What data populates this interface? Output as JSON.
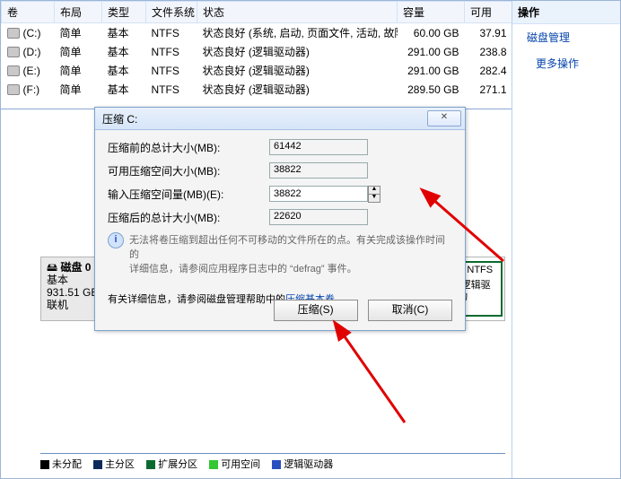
{
  "rightPane": {
    "header": "操作",
    "items": [
      "磁盘管理",
      "更多操作"
    ]
  },
  "table": {
    "headers": {
      "vol": "卷",
      "layout": "布局",
      "type": "类型",
      "fs": "文件系统",
      "status": "状态",
      "cap": "容量",
      "free": "可用"
    },
    "rows": [
      {
        "vol": "(C:)",
        "layout": "简单",
        "type": "基本",
        "fs": "NTFS",
        "status": "状态良好 (系统, 启动, 页面文件, 活动, 故障转储, 主分区)",
        "cap": "60.00 GB",
        "free": "37.91"
      },
      {
        "vol": "(D:)",
        "layout": "简单",
        "type": "基本",
        "fs": "NTFS",
        "status": "状态良好 (逻辑驱动器)",
        "cap": "291.00 GB",
        "free": "238.8"
      },
      {
        "vol": "(E:)",
        "layout": "简单",
        "type": "基本",
        "fs": "NTFS",
        "status": "状态良好 (逻辑驱动器)",
        "cap": "291.00 GB",
        "free": "282.4"
      },
      {
        "vol": "(F:)",
        "layout": "简单",
        "type": "基本",
        "fs": "NTFS",
        "status": "状态良好 (逻辑驱动器)",
        "cap": "289.50 GB",
        "free": "271.1"
      }
    ]
  },
  "diskMap": {
    "disk_icon_label": "磁盘 0",
    "type": "基本",
    "size": "931.51 GB",
    "status": "联机",
    "part1_line1": "B NTFS",
    "part1_line2": "(逻辑驱动"
  },
  "legend": {
    "unalloc": "未分配",
    "primary": "主分区",
    "extended": "扩展分区",
    "free": "可用空间",
    "logical": "逻辑驱动器"
  },
  "dialog": {
    "title": "压缩 C:",
    "labels": {
      "total_before": "压缩前的总计大小(MB):",
      "avail": "可用压缩空间大小(MB):",
      "shrink": "输入压缩空间量(MB)(E):",
      "total_after": "压缩后的总计大小(MB):"
    },
    "values": {
      "total_before": "61442",
      "avail": "38822",
      "shrink": "38822",
      "total_after": "22620"
    },
    "info_line1": "无法将卷压缩到超出任何不可移动的文件所在的点。有关完成该操作时间的",
    "info_line2_a": "详细信息，请参阅应用程序日志中的 “",
    "info_line2_b": "defrag",
    "info_line2_c": "” 事件。",
    "more_info_a": "有关详细信息，请参阅磁盘管理帮助中的",
    "more_info_link": "压缩基本卷",
    "more_info_b": "。",
    "btn_shrink": "压缩(S)",
    "btn_cancel": "取消(C)"
  }
}
